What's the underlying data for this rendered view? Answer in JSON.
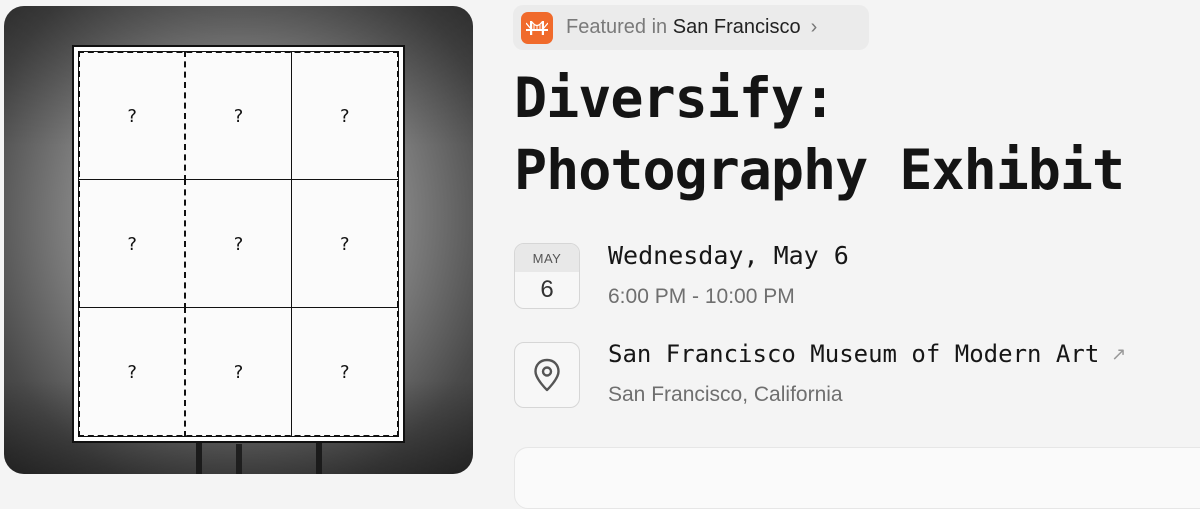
{
  "featured": {
    "prefix": "Featured in",
    "city": "San Francisco",
    "chevron": "›",
    "badge_icon": "golden-gate-bridge-icon",
    "badge_color": "#f06a2b"
  },
  "event": {
    "title_line1": "Diversify:",
    "title_line2": "Photography Exhibit"
  },
  "date": {
    "month": "MAY",
    "day": "6",
    "full": "Wednesday, May 6",
    "time": "6:00 PM - 10:00 PM"
  },
  "location": {
    "icon": "map-pin-icon",
    "venue": "San Francisco Museum of Modern Art",
    "venue_arrow": "↗",
    "city": "San Francisco, California"
  },
  "cover": {
    "cells": [
      "?",
      "?",
      "?",
      "?",
      "?",
      "?",
      "?",
      "?",
      "?"
    ]
  }
}
